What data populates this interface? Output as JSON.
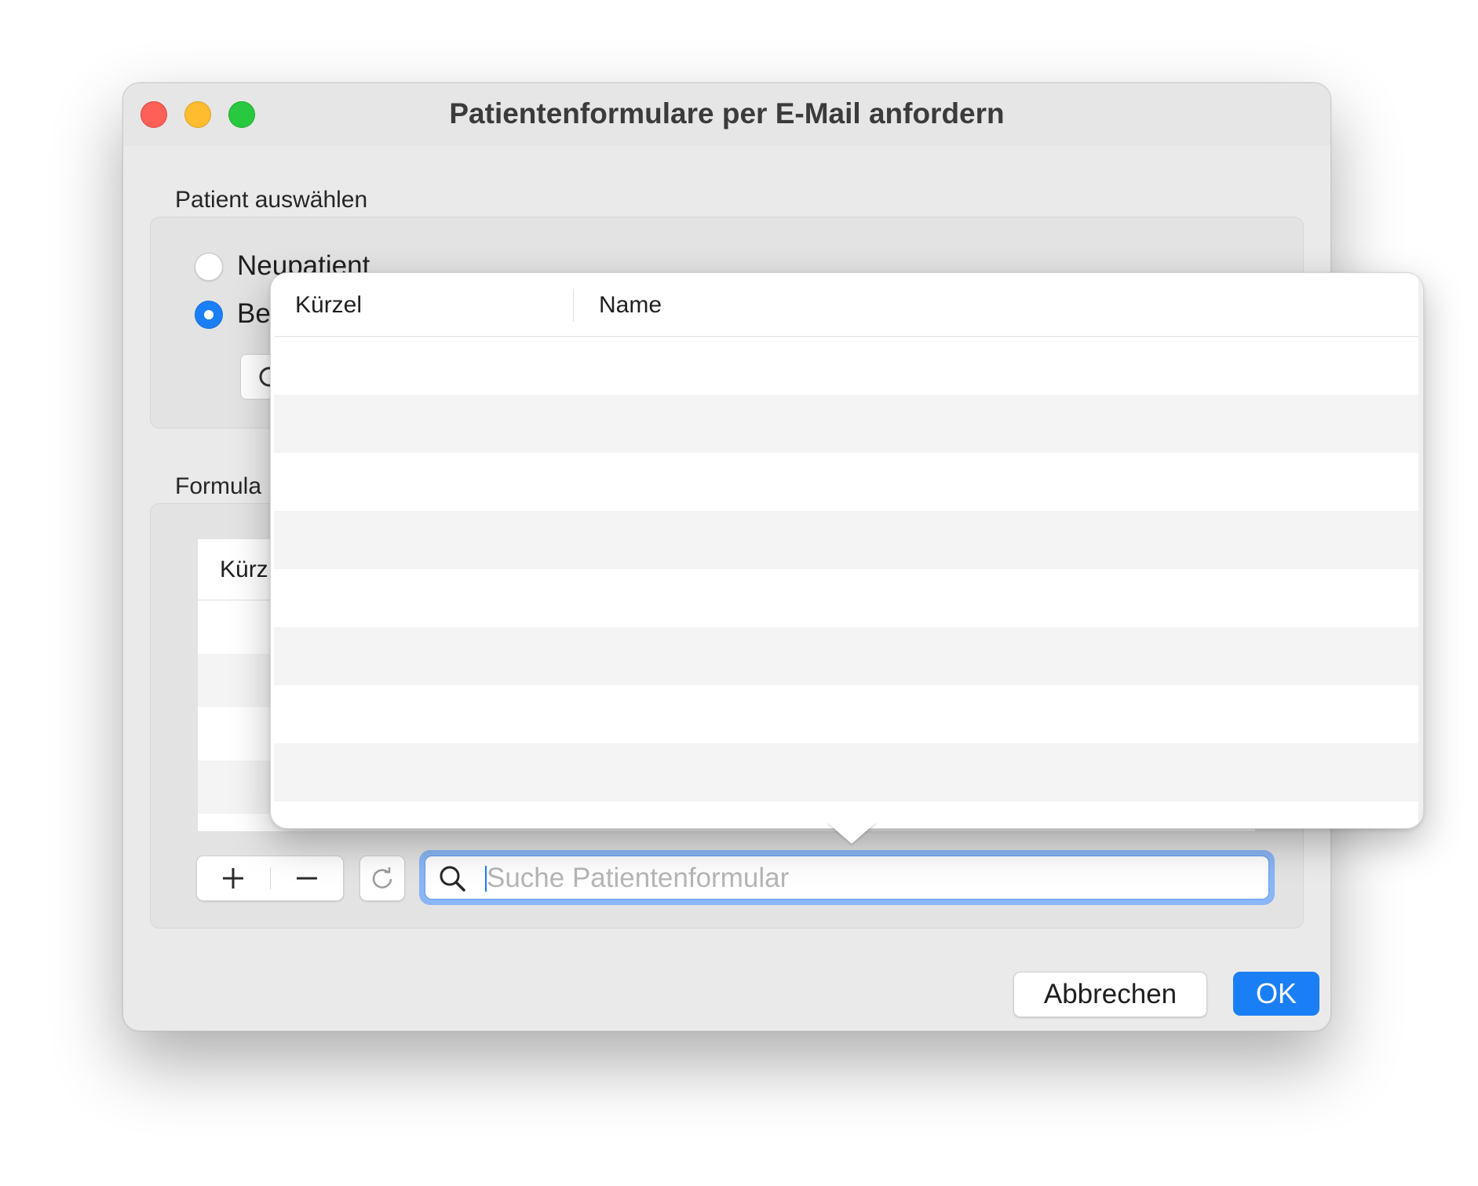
{
  "window": {
    "title": "Patientenformulare per E-Mail anfordern"
  },
  "patient_section": {
    "label": "Patient auswählen",
    "options": [
      {
        "label": "Neupatient",
        "selected": false
      },
      {
        "label": "Be",
        "selected": true
      }
    ]
  },
  "forms_section": {
    "label": "Formula",
    "table_header_partial": "Kürz"
  },
  "toolbar": {
    "add_icon": "plus-icon",
    "remove_icon": "minus-icon",
    "refresh_icon": "refresh-icon"
  },
  "search": {
    "placeholder": "Suche Patientenformular",
    "value": "",
    "icon": "search-icon"
  },
  "buttons": {
    "cancel": "Abbrechen",
    "ok": "OK"
  },
  "popover": {
    "columns": [
      "Kürzel",
      "Name"
    ],
    "rows": []
  },
  "colors": {
    "accent": "#1a7ff5",
    "window_bg": "#ebeaea",
    "traffic_close": "#fe5f57",
    "traffic_minimize": "#febc2e",
    "traffic_zoom": "#28c840"
  }
}
